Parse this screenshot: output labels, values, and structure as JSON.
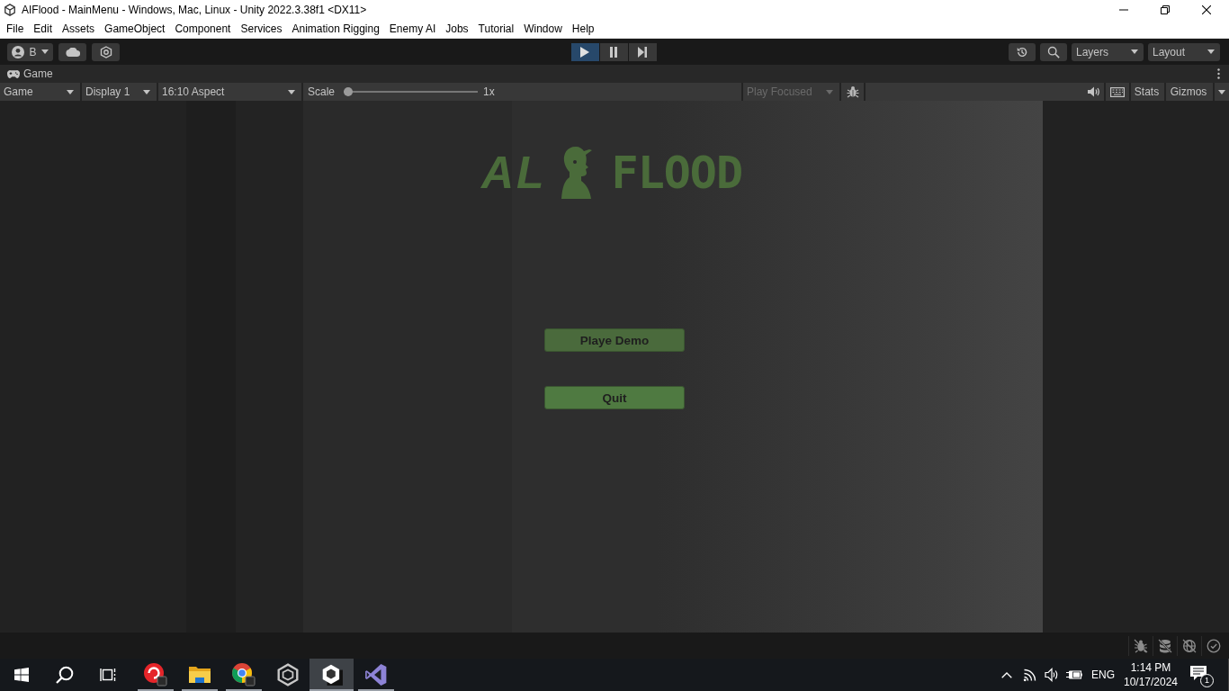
{
  "window": {
    "title": "AIFlood - MainMenu - Windows, Mac, Linux - Unity 2022.3.38f1 <DX11>"
  },
  "menu": [
    "File",
    "Edit",
    "Assets",
    "GameObject",
    "Component",
    "Services",
    "Animation Rigging",
    "Enemy AI",
    "Jobs",
    "Tutorial",
    "Window",
    "Help"
  ],
  "toolbar": {
    "account": "B",
    "play_controls": [
      {
        "kind": "play",
        "selected": true
      },
      {
        "kind": "pause",
        "selected": false
      },
      {
        "kind": "step",
        "selected": false
      }
    ],
    "layers": "Layers",
    "layout": "Layout"
  },
  "panel": {
    "tab": "Game"
  },
  "game_toolbar": {
    "view": "Game",
    "display": "Display 1",
    "aspect": "16:10 Aspect",
    "scale": {
      "label": "Scale",
      "level": 0,
      "reading": "1x"
    },
    "play_focused": {
      "label": "Play Focused",
      "disabled": true
    },
    "stats": "Stats",
    "gizmos": "Gizmos"
  },
  "game": {
    "logo": {
      "left": "AL",
      "right": "FLOOD"
    },
    "buttons": [
      {
        "label": "Playe Demo",
        "highlighted": false
      },
      {
        "label": "Quit",
        "highlighted": true
      }
    ]
  },
  "taskbar": {
    "apps": [
      {
        "kind": "record",
        "running": true,
        "selected": false
      },
      {
        "kind": "folder",
        "running": true,
        "selected": false
      },
      {
        "kind": "browser",
        "running": true,
        "selected": false
      },
      {
        "kind": "hub",
        "running": false,
        "selected": false
      },
      {
        "kind": "editor",
        "running": true,
        "selected": true
      },
      {
        "kind": "code",
        "running": true,
        "selected": false
      }
    ],
    "language": "ENG",
    "time": "1:14 PM",
    "date": "10/17/2024",
    "notifications": "1"
  }
}
